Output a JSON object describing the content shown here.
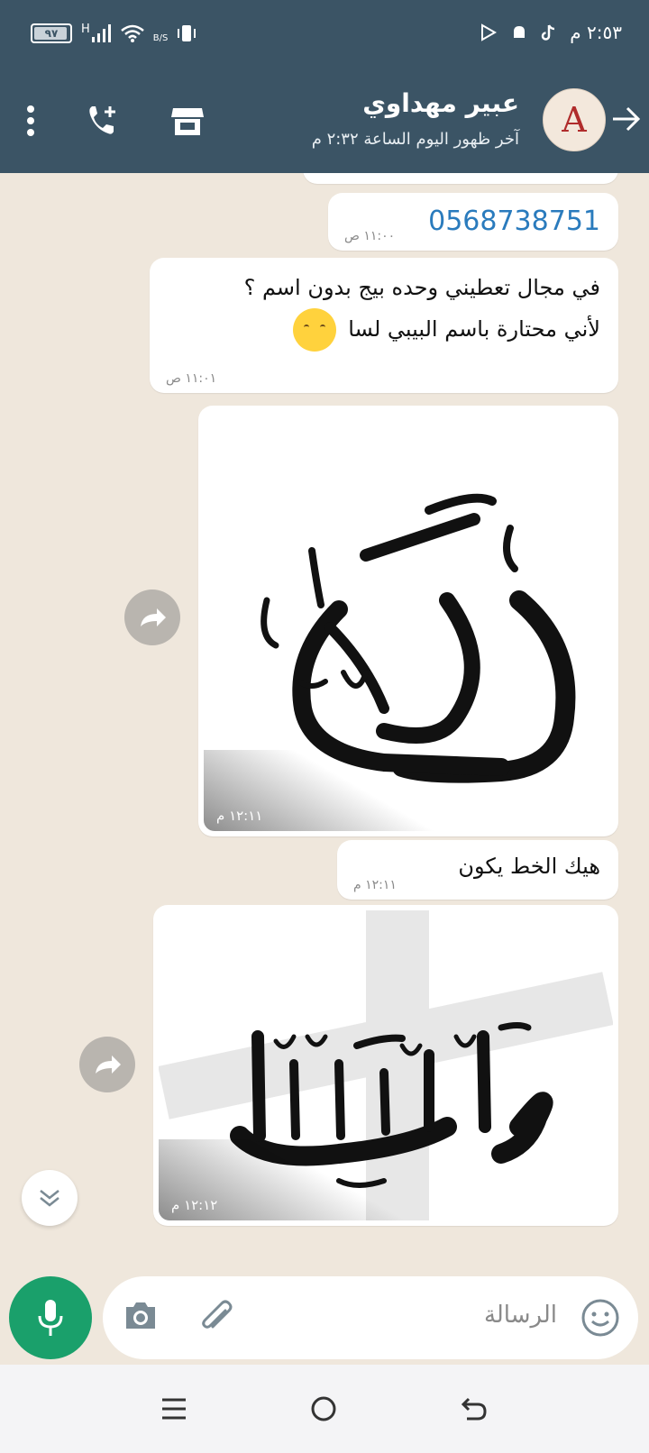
{
  "status_bar": {
    "battery": "٩٧",
    "network": "H",
    "data_label": "B/S",
    "time": "٢:٥٣ م"
  },
  "header": {
    "contact_name": "عبير مهداوي",
    "last_seen": "آخر ظهور اليوم الساعة ٢:٣٢ م",
    "avatar_letter": "A"
  },
  "messages": [
    {
      "type": "link",
      "text": "0568738751",
      "time": "١١:٠٠ ص"
    },
    {
      "type": "text",
      "line1": "في مجال تعطيني وحده بيج بدون اسم ؟",
      "line2": "لأني محتارة باسم البيبي لسا",
      "time": "١١:٠١ ص"
    },
    {
      "type": "image",
      "calligraphy": "ندى",
      "time": "١٢:١١ م"
    },
    {
      "type": "text",
      "line1": "هيك الخط يكون",
      "time": "١٢:١١ م"
    },
    {
      "type": "image",
      "calligraphy": "مانيسا",
      "time": "١٢:١٢ م"
    }
  ],
  "composer": {
    "placeholder": "الرسالة"
  },
  "icons": {
    "back": "arrow-right-icon",
    "call": "add-call-icon",
    "store": "store-icon",
    "menu": "more-vert-icon",
    "forward": "forward-icon",
    "scroll": "chevrons-down-icon",
    "mic": "mic-icon",
    "camera": "camera-icon",
    "attach": "paperclip-icon",
    "emoji": "emoji-icon"
  },
  "colors": {
    "header_bg": "#3b5465",
    "chat_bg": "#efe7dc",
    "link": "#2a7bbd",
    "mic_bg": "#1aa06b"
  }
}
